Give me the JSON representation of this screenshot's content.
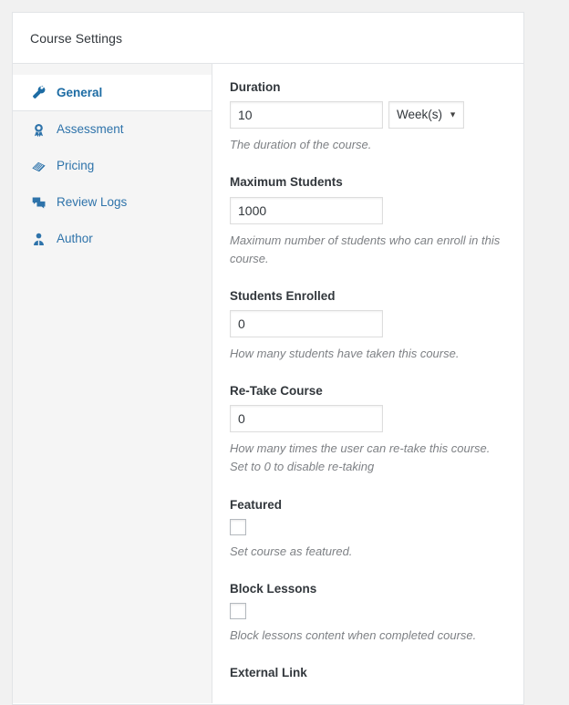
{
  "panel": {
    "title": "Course Settings"
  },
  "sidebar": {
    "items": [
      {
        "label": "General",
        "icon": "wrench-icon",
        "active": true
      },
      {
        "label": "Assessment",
        "icon": "award-icon",
        "active": false
      },
      {
        "label": "Pricing",
        "icon": "money-icon",
        "active": false
      },
      {
        "label": "Review Logs",
        "icon": "chat-bubbles-icon",
        "active": false
      },
      {
        "label": "Author",
        "icon": "person-icon",
        "active": false
      }
    ]
  },
  "fields": {
    "duration": {
      "label": "Duration",
      "value": "10",
      "unit_selected": "Week(s)",
      "description": "The duration of the course."
    },
    "maximum_students": {
      "label": "Maximum Students",
      "value": "1000",
      "description": "Maximum number of students who can enroll in this course."
    },
    "students_enrolled": {
      "label": "Students Enrolled",
      "value": "0",
      "description": "How many students have taken this course."
    },
    "retake_course": {
      "label": "Re-Take Course",
      "value": "0",
      "description": "How many times the user can re-take this course. Set to 0 to disable re-taking"
    },
    "featured": {
      "label": "Featured",
      "checked": false,
      "description": "Set course as featured."
    },
    "block_lessons": {
      "label": "Block Lessons",
      "checked": false,
      "description": "Block lessons content when completed course."
    },
    "external_link": {
      "label": "External Link"
    }
  },
  "colors": {
    "accent": "#2e73aa",
    "panel_bg": "#ffffff",
    "page_bg": "#f1f1f1",
    "sidebar_bg": "#f5f5f5",
    "border": "#e2e4e7",
    "text": "#32373c",
    "muted": "#7e8185"
  }
}
